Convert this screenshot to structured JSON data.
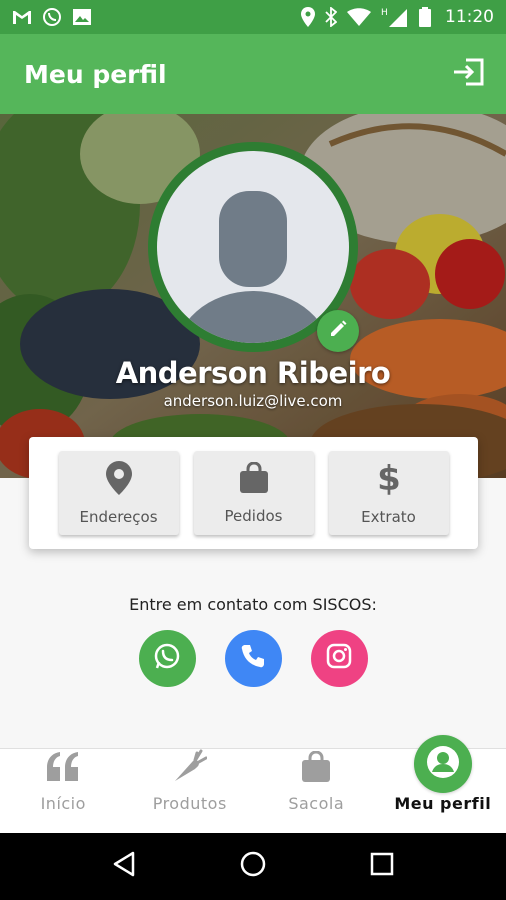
{
  "status_bar": {
    "time": "11:20",
    "left_icons": [
      "gmail-icon",
      "whatsapp-icon",
      "image-icon"
    ],
    "right_icons": [
      "location-icon",
      "bluetooth-icon",
      "wifi-icon",
      "signal-icon",
      "battery-icon"
    ]
  },
  "app_bar": {
    "title": "Meu perfil",
    "logout_icon": "logout-icon"
  },
  "profile": {
    "name": "Anderson Ribeiro",
    "email": "anderson.luiz@live.com",
    "edit_icon": "pencil-icon"
  },
  "actions": [
    {
      "label": "Endereços",
      "icon": "map-pin-icon"
    },
    {
      "label": "Pedidos",
      "icon": "shopping-bag-icon"
    },
    {
      "label": "Extrato",
      "icon": "dollar-icon"
    }
  ],
  "contact": {
    "title": "Entre em contato com SISCOS:",
    "buttons": [
      {
        "icon": "whatsapp-icon",
        "color": "#4caf50"
      },
      {
        "icon": "phone-icon",
        "color": "#3f87f5"
      },
      {
        "icon": "instagram-icon",
        "color": "#ef4283"
      }
    ]
  },
  "bottom_nav": {
    "items": [
      {
        "label": "Início",
        "icon": "quote-icon",
        "active": false
      },
      {
        "label": "Produtos",
        "icon": "carrot-icon",
        "active": false
      },
      {
        "label": "Sacola",
        "icon": "bag-icon",
        "active": false
      },
      {
        "label": "Meu perfil",
        "icon": "user-icon",
        "active": true
      }
    ]
  },
  "colors": {
    "status_bar": "#3f9f46",
    "app_bar": "#55b65a",
    "accent": "#4caf50",
    "avatar_ring": "#2e7d32"
  }
}
